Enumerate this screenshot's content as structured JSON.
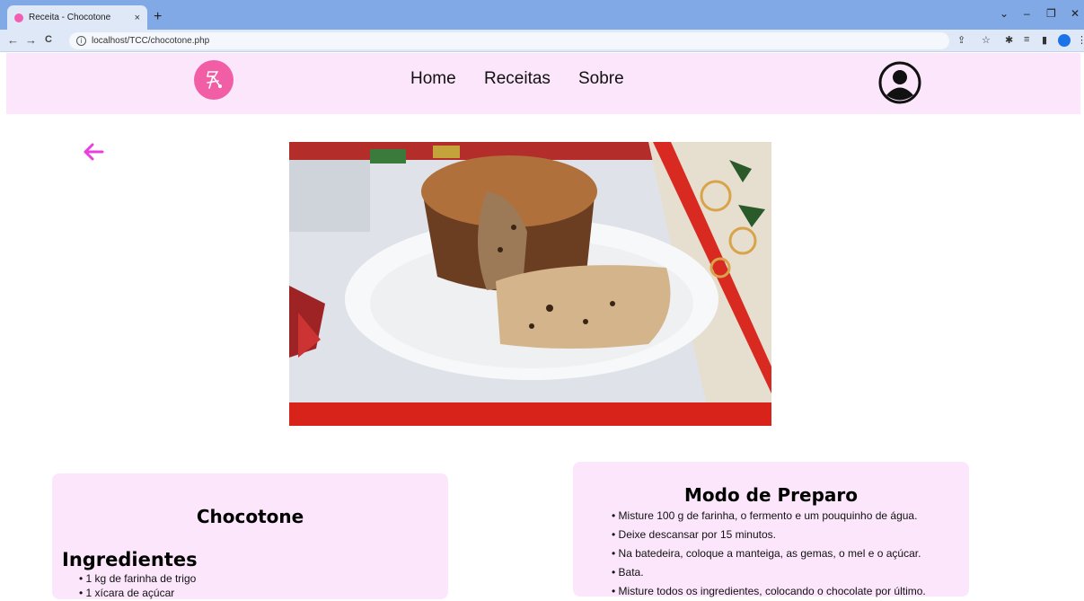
{
  "browser": {
    "tab_title": "Receita - Chocotone",
    "tab_close": "×",
    "new_tab": "+",
    "url": "localhost/TCC/chocotone.php",
    "nav": {
      "back": "←",
      "forward": "→",
      "reload": "C",
      "info": "i"
    },
    "window_controls": {
      "dropdown": "⌄",
      "minimize": "–",
      "restore": "❐",
      "close": "✕"
    },
    "toolbar_icons": {
      "share": "⇪",
      "bookmark": "☆",
      "extensions": "✱",
      "reading_list": "≡",
      "sidebar": "▮",
      "more": "⋮"
    }
  },
  "site": {
    "nav_items": [
      "Home",
      "Receitas",
      "Sobre"
    ],
    "colors": {
      "header_bg": "#fce6fb",
      "accent": "#f15ea6",
      "back_arrow": "#e83fe0",
      "card_bg": "#fce6fb"
    }
  },
  "recipe": {
    "name": "Chocotone",
    "ingredients_heading": "Ingredientes",
    "ingredients": [
      "1 kg de farinha de trigo",
      "1 xícara de açúcar"
    ],
    "prep_heading": "Modo de Preparo",
    "steps": [
      "Misture 100 g de farinha, o fermento e um pouquinho de água.",
      "Deixe descansar por 15 minutos.",
      "Na batedeira, coloque a manteiga, as gemas, o mel e o açúcar.",
      "Bata.",
      "Misture todos os ingredientes, colocando o chocolate por último."
    ]
  }
}
